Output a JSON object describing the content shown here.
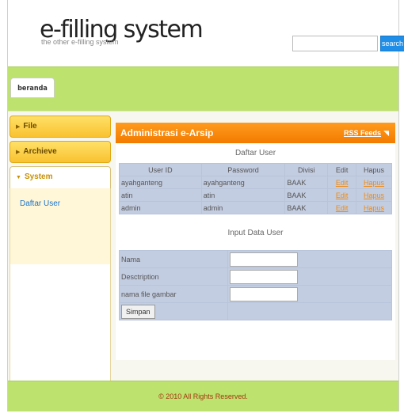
{
  "header": {
    "title": "e-filling system",
    "tagline": "the other e-filling system",
    "search_placeholder": "",
    "search_label": "search"
  },
  "nav": {
    "tabs": [
      {
        "label": "beranda"
      }
    ]
  },
  "sidebar": {
    "sections": [
      {
        "label": "File"
      },
      {
        "label": "Archieve"
      },
      {
        "label": "System"
      }
    ],
    "system_items": [
      {
        "label": "Daftar User"
      }
    ]
  },
  "content": {
    "title": "Administrasi e-Arsip",
    "rss_label": "RSS Feeds",
    "user_list_title": "Daftar User",
    "user_table": {
      "headers": [
        "User ID",
        "Password",
        "Divisi",
        "Edit",
        "Hapus"
      ],
      "rows": [
        [
          "ayahganteng",
          "ayahganteng",
          "BAAK",
          "Edit",
          "Hapus"
        ],
        [
          "atin",
          "atin",
          "BAAK",
          "Edit",
          "Hapus"
        ],
        [
          "admin",
          "admin",
          "BAAK",
          "Edit",
          "Hapus"
        ]
      ]
    },
    "input_title": "Input Data User",
    "form": {
      "fields": [
        {
          "label": "Nama",
          "value": ""
        },
        {
          "label": "Desctription",
          "value": ""
        },
        {
          "label": "nama file gambar",
          "value": ""
        }
      ],
      "submit_label": "Simpan"
    }
  },
  "footer": {
    "text": "© 2010 All Rights Reserved."
  },
  "colors": {
    "nav_green": "#bde26e",
    "accent_orange": "#f27b00",
    "sidebar_yellow": "#f9c230",
    "search_blue": "#1e8ee8",
    "table_blue": "#c3cde1",
    "link_orange": "#f08a10"
  }
}
